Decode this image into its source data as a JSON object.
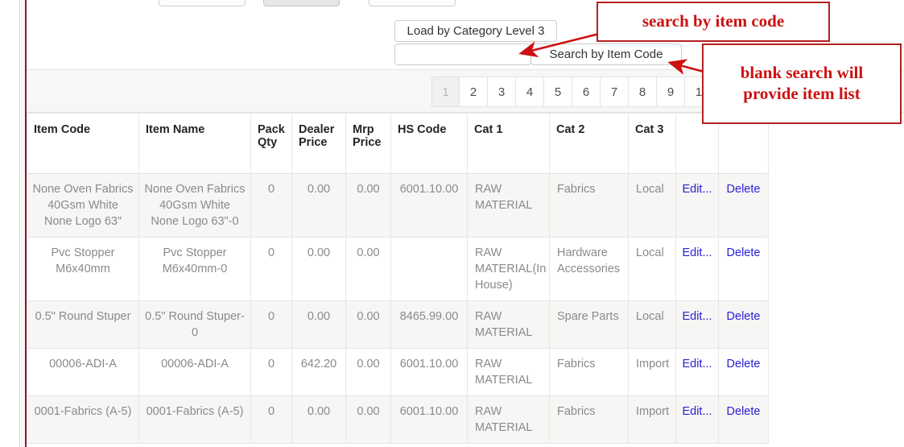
{
  "toolbar": {
    "load_by_category_level3": "Load by Category Level 3",
    "search_by_item_code": "Search by Item Code",
    "search_input_value": "",
    "search_input_placeholder": ""
  },
  "pagination": {
    "pages": [
      "1",
      "2",
      "3",
      "4",
      "5",
      "6",
      "7",
      "8",
      "9",
      "1"
    ],
    "active": "1"
  },
  "table": {
    "headers": [
      "Item Code",
      "Item Name",
      "Pack Qty",
      "Dealer Price",
      "Mrp Price",
      "HS Code",
      "Cat 1",
      "Cat 2",
      "Cat 3",
      "",
      ""
    ],
    "edit_label": "Edit...",
    "delete_label": "Delete",
    "rows": [
      {
        "item_code": "None Oven Fabrics 40Gsm White None Logo 63\"",
        "item_name": "None Oven Fabrics 40Gsm White None Logo 63\"-0",
        "pack_qty": "0",
        "dealer_price": "0.00",
        "mrp_price": "0.00",
        "hs_code": "6001.10.00",
        "cat1": "RAW MATERIAL",
        "cat2": "Fabrics",
        "cat3": "Local"
      },
      {
        "item_code": "Pvc Stopper M6x40mm",
        "item_name": "Pvc Stopper M6x40mm-0",
        "pack_qty": "0",
        "dealer_price": "0.00",
        "mrp_price": "0.00",
        "hs_code": "",
        "cat1": "RAW MATERIAL(In House)",
        "cat2": "Hardware Accessories",
        "cat3": "Local"
      },
      {
        "item_code": "0.5\" Round Stuper",
        "item_name": "0.5\" Round Stuper-0",
        "pack_qty": "0",
        "dealer_price": "0.00",
        "mrp_price": "0.00",
        "hs_code": "8465.99.00",
        "cat1": "RAW MATERIAL",
        "cat2": "Spare Parts",
        "cat3": "Local"
      },
      {
        "item_code": "00006-ADI-A",
        "item_name": "00006-ADI-A",
        "pack_qty": "0",
        "dealer_price": "642.20",
        "mrp_price": "0.00",
        "hs_code": "6001.10.00",
        "cat1": "RAW MATERIAL",
        "cat2": "Fabrics",
        "cat3": "Import"
      },
      {
        "item_code": "0001-Fabrics (A-5)",
        "item_name": "0001-Fabrics (A-5)",
        "pack_qty": "0",
        "dealer_price": "0.00",
        "mrp_price": "0.00",
        "hs_code": "6001.10.00",
        "cat1": "RAW MATERIAL",
        "cat2": "Fabrics",
        "cat3": "Import"
      }
    ]
  },
  "annotations": {
    "search_by_item_code": "search by item code",
    "blank_search_line1": "blank search will",
    "blank_search_line2": "provide item list"
  },
  "colors": {
    "annotation_red": "#cc1111",
    "annotation_border": "#b3201f",
    "link_blue": "#2b20d6",
    "rail_red": "#8b1a2b",
    "row_stripe": "#f7f6f4"
  }
}
